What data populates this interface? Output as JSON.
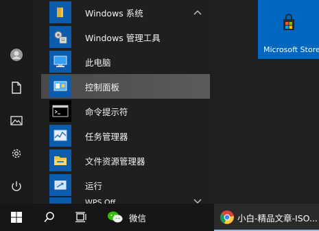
{
  "rail": {
    "items": [
      {
        "name": "user-avatar",
        "icon": "user-icon"
      },
      {
        "name": "documents",
        "icon": "document-icon"
      },
      {
        "name": "pictures",
        "icon": "picture-icon"
      },
      {
        "name": "settings",
        "icon": "gear-icon"
      },
      {
        "name": "power",
        "icon": "power-icon"
      }
    ]
  },
  "applist": {
    "group": {
      "label": "Windows 系统",
      "icon": "folder-icon"
    },
    "items": [
      {
        "label": "Windows 管理工具",
        "icon": "admin-tools-icon"
      },
      {
        "label": "此电脑",
        "icon": "computer-icon"
      },
      {
        "label": "控制面板",
        "icon": "control-panel-icon"
      },
      {
        "label": "命令提示符",
        "icon": "cmd-icon"
      },
      {
        "label": "任务管理器",
        "icon": "task-manager-icon"
      },
      {
        "label": "文件资源管理器",
        "icon": "file-explorer-icon"
      },
      {
        "label": "运行",
        "icon": "run-icon"
      }
    ],
    "next_group": {
      "label": "WPS Off"
    }
  },
  "tiles": {
    "store": {
      "label": "Microsoft Store",
      "color": "#0067c0"
    }
  },
  "taskbar": {
    "wechat": {
      "label": "微信"
    },
    "browser": {
      "label": "小白-精品文章-ISO..."
    }
  },
  "colors": {
    "accent": "#0078d7",
    "highlight": "#555555",
    "taskbar": "#161616"
  }
}
